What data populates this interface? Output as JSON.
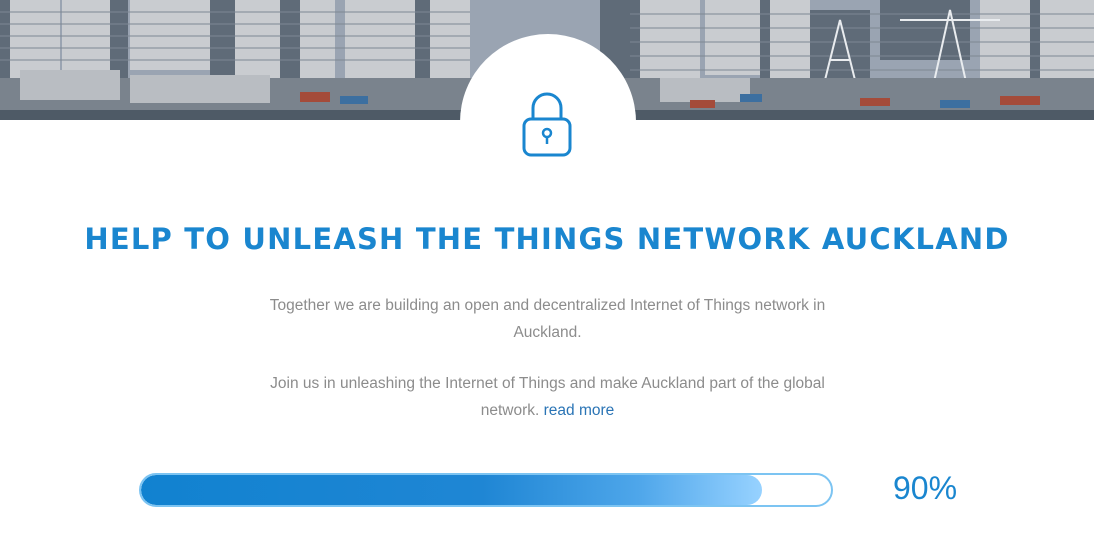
{
  "banner": {
    "image_description": "Auckland city waterfront skyline"
  },
  "lock": {
    "icon": "lock-icon",
    "color": "#1a86cf"
  },
  "headline": "HELP TO UNLEASH THE THINGS NETWORK AUCKLAND",
  "intro": {
    "paragraph_1": "Together we are building an open and decentralized Internet of Things network in Auckland.",
    "paragraph_2": "Join us in unleashing the Internet of Things and make Auckland part of the global network.",
    "read_more_label": "read more"
  },
  "progress": {
    "percent": 90,
    "label": "90%",
    "fill_fraction": 0.9
  },
  "colors": {
    "accent": "#1a86cf",
    "link": "#2a74b5",
    "body_text": "#8c8c8c",
    "track_border": "#7cc4f2"
  }
}
